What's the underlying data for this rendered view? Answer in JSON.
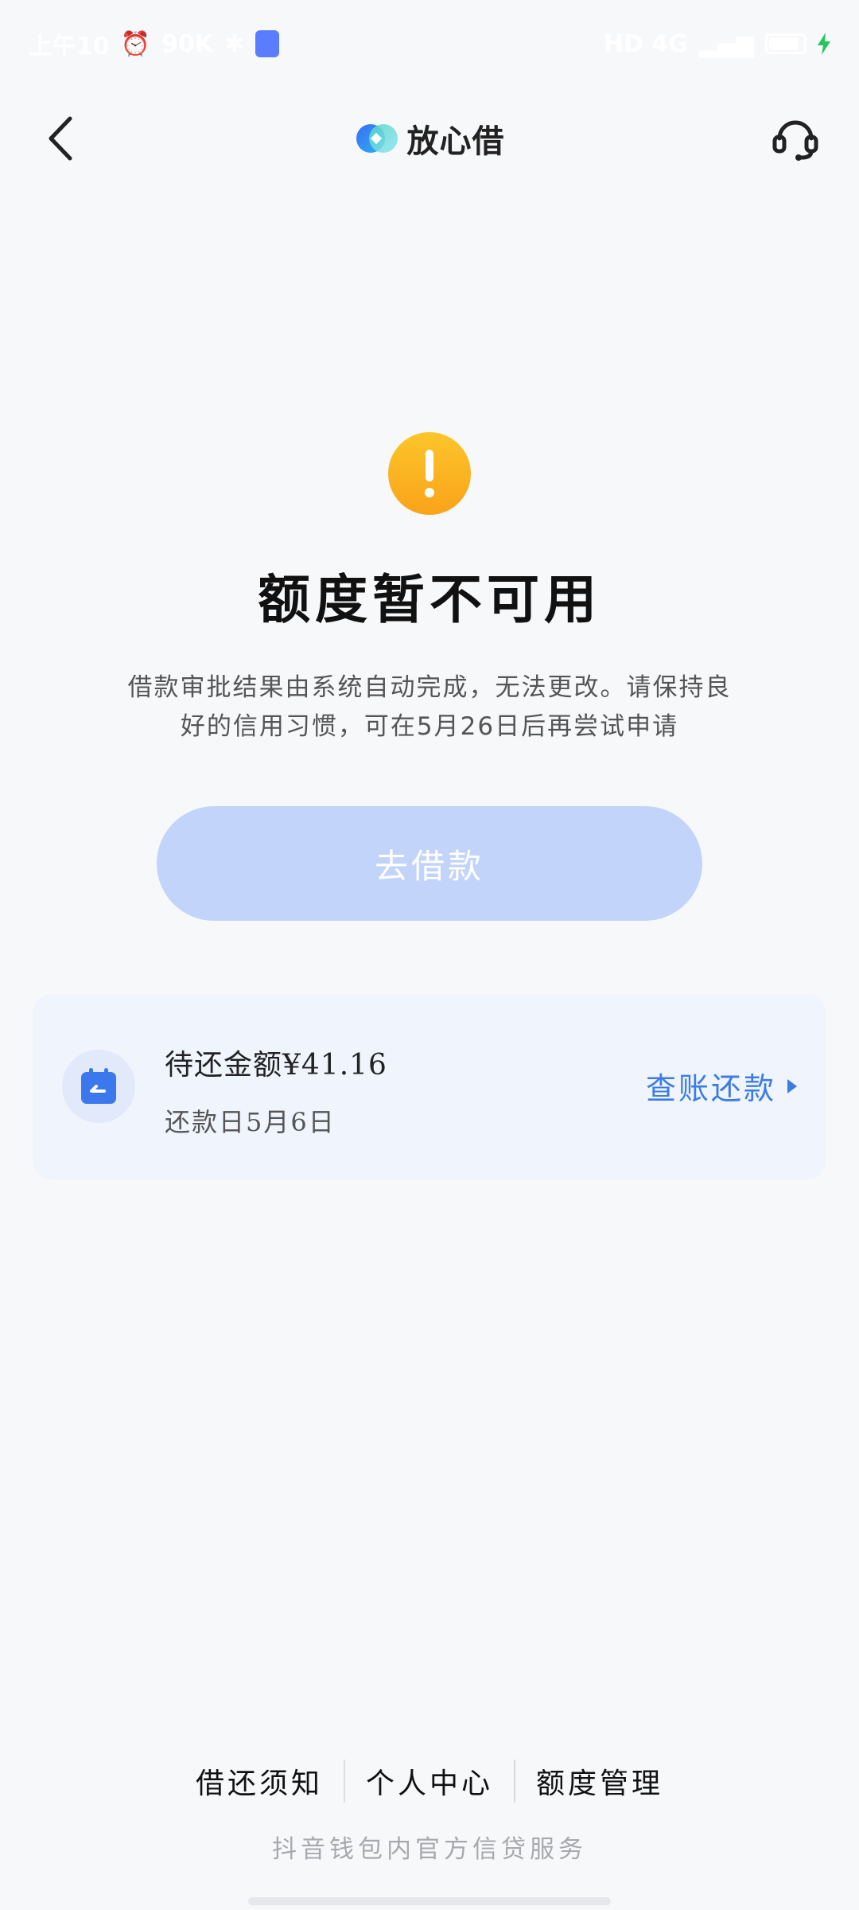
{
  "status_bar": {
    "time": "上午10",
    "speed": "90K",
    "network": "HD 4G"
  },
  "header": {
    "brand": "放心借",
    "icons": {
      "back": "back-arrow-icon",
      "support": "headset-icon"
    }
  },
  "result": {
    "icon": "warning-icon",
    "title": "额度暂不可用",
    "desc_line1": "借款审批结果由系统自动完成，无法更改。请保持良",
    "desc_line2": "好的信用习惯，可在5月26日后再尝试申请",
    "button_label": "去借款"
  },
  "repayment": {
    "amount_text": "待还金额¥41.16",
    "date_text": "还款日5月6日",
    "link_label": "查账还款",
    "icon": "calendar-icon"
  },
  "bottom_nav": [
    {
      "label": "借还须知"
    },
    {
      "label": "个人中心"
    },
    {
      "label": "额度管理"
    }
  ],
  "footer": {
    "note": "抖音钱包内官方信贷服务"
  },
  "colors": {
    "accent": "#3d7ce5",
    "button_disabled": "#c2d4fa",
    "warning": "#fbb21c",
    "card_bg": "#eff4fd"
  }
}
